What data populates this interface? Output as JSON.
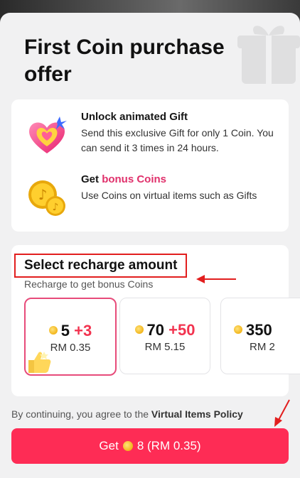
{
  "sheet": {
    "title": "First Coin purchase offer"
  },
  "features": [
    {
      "icon": "animated-heart-gift-icon",
      "title": "Unlock animated Gift",
      "description": "Send this exclusive Gift for only 1 Coin. You can send it 3 times in 24 hours."
    },
    {
      "icon": "tiktok-coins-icon",
      "title_prefix": "Get ",
      "title_highlight": "bonus Coins",
      "description": "Use Coins on virtual items such as Gifts"
    }
  ],
  "recharge": {
    "title": "Select recharge amount",
    "subtitle": "Recharge to get bonus Coins",
    "options": [
      {
        "coins": "5",
        "bonus": "+3",
        "price": "RM 0.35",
        "selected": true
      },
      {
        "coins": "70",
        "bonus": "+50",
        "price": "RM 5.15",
        "selected": false
      },
      {
        "coins": "350",
        "bonus": "",
        "price": "RM 2",
        "selected": false
      }
    ]
  },
  "consent": {
    "text": "By continuing, you agree to the ",
    "link": "Virtual Items Policy"
  },
  "buy_button": {
    "prefix": "Get",
    "suffix": "8 (RM 0.35)"
  },
  "colors": {
    "accent": "#fe2c55",
    "bonus": "#e0306b",
    "annotation": "#e21e1e"
  }
}
